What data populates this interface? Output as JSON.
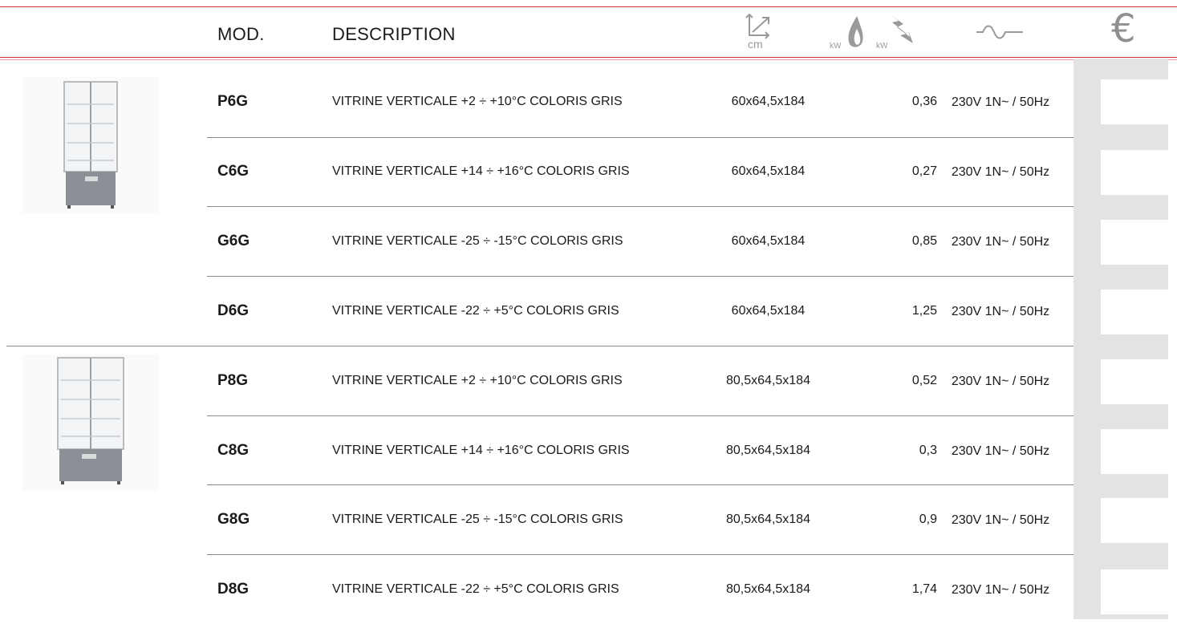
{
  "header": {
    "mod_label": "MOD.",
    "description_label": "DESCRIPTION",
    "dimensions_icon": "dimensions-cm-icon",
    "dimensions_unit": "cm",
    "gas_power_icon": "gas-flame-kw-icon",
    "electric_power_icon": "electric-kw-icon",
    "power_unit": "kW",
    "voltage_icon": "voltage-icon",
    "price_icon": "euro-icon",
    "price_symbol": "€"
  },
  "rows": [
    {
      "mod": "P6G",
      "description": "VITRINE VERTICALE +2 ÷ +10°C COLORIS GRIS",
      "dimensions": "60x64,5x184",
      "kw": "0,36",
      "voltage": "230V 1N~ / 50Hz"
    },
    {
      "mod": "C6G",
      "description": "VITRINE VERTICALE +14 ÷ +16°C COLORIS GRIS",
      "dimensions": "60x64,5x184",
      "kw": "0,27",
      "voltage": "230V 1N~ / 50Hz"
    },
    {
      "mod": "G6G",
      "description": "VITRINE VERTICALE -25 ÷ -15°C COLORIS GRIS",
      "dimensions": "60x64,5x184",
      "kw": "0,85",
      "voltage": "230V 1N~ / 50Hz"
    },
    {
      "mod": "D6G",
      "description": "VITRINE VERTICALE -22 ÷ +5°C COLORIS GRIS",
      "dimensions": "60x64,5x184",
      "kw": "1,25",
      "voltage": "230V 1N~ / 50Hz"
    },
    {
      "mod": "P8G",
      "description": "VITRINE VERTICALE +2 ÷ +10°C COLORIS GRIS",
      "dimensions": "80,5x64,5x184",
      "kw": "0,52",
      "voltage": "230V 1N~ / 50Hz"
    },
    {
      "mod": "C8G",
      "description": "VITRINE VERTICALE +14 ÷ +16°C COLORIS GRIS",
      "dimensions": "80,5x64,5x184",
      "kw": "0,3",
      "voltage": "230V 1N~ / 50Hz"
    },
    {
      "mod": "G8G",
      "description": "VITRINE VERTICALE -25 ÷ -15°C COLORIS GRIS",
      "dimensions": "80,5x64,5x184",
      "kw": "0,9",
      "voltage": "230V 1N~ / 50Hz"
    },
    {
      "mod": "D8G",
      "description": "VITRINE VERTICALE -22 ÷ +5°C COLORIS GRIS",
      "dimensions": "80,5x64,5x184",
      "kw": "1,74",
      "voltage": "230V 1N~ / 50Hz"
    }
  ],
  "colors": {
    "accent_red": "#d0303a",
    "price_column_gray": "#e3e3e3",
    "divider_gray": "#8a8a8a"
  }
}
